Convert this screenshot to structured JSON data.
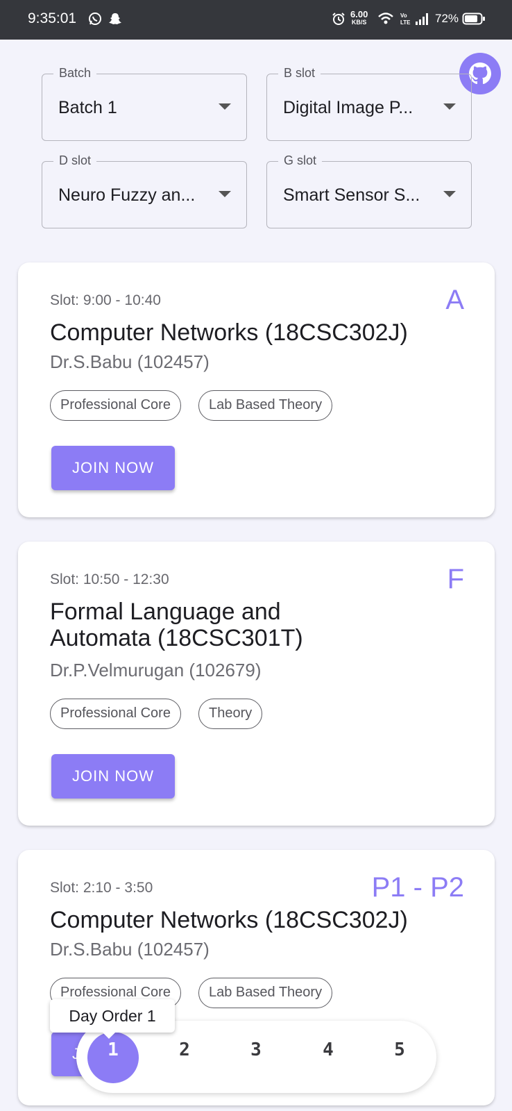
{
  "status_bar": {
    "time": "9:35:01",
    "speed_value": "6.00",
    "speed_unit": "KB/S",
    "battery": "72%"
  },
  "filters": [
    {
      "label": "Batch",
      "value": "Batch 1"
    },
    {
      "label": "B slot",
      "value": "Digital Image P..."
    },
    {
      "label": "D slot",
      "value": "Neuro Fuzzy an..."
    },
    {
      "label": "G slot",
      "value": "Smart Sensor S..."
    }
  ],
  "classes": [
    {
      "slot": "Slot: 9:00 - 10:40",
      "code": "A",
      "title": "Computer Networks (18CSC302J)",
      "teacher": "Dr.S.Babu (102457)",
      "tags": [
        "Professional Core",
        "Lab Based Theory"
      ],
      "button": "JOIN NOW"
    },
    {
      "slot": "Slot: 10:50 - 12:30",
      "code": "F",
      "title": "Formal Language and Automata (18CSC301T)",
      "teacher": "Dr.P.Velmurugan (102679)",
      "tags": [
        "Professional Core",
        "Theory"
      ],
      "button": "JOIN NOW"
    },
    {
      "slot": "Slot: 2:10 - 3:50",
      "code": "P1 - P2",
      "title": "Computer Networks (18CSC302J)",
      "teacher": "Dr.S.Babu (102457)",
      "tags": [
        "Professional Core",
        "Lab Based Theory"
      ],
      "button": "JOIN NOW"
    }
  ],
  "day_order": {
    "tooltip": "Day Order 1",
    "days": [
      "1",
      "2",
      "3",
      "4",
      "5"
    ],
    "selected": "1"
  },
  "colors": {
    "accent": "#8c7cf5",
    "status_bar": "#35373c",
    "background": "#f3f3fb"
  },
  "icons": {
    "github": "github-icon",
    "whatsapp": "whatsapp-icon",
    "snapchat": "snapchat-icon",
    "alarm": "alarm-icon",
    "wifi": "wifi-icon",
    "volte": "volte-icon",
    "signal": "signal-icon",
    "battery": "battery-icon"
  }
}
